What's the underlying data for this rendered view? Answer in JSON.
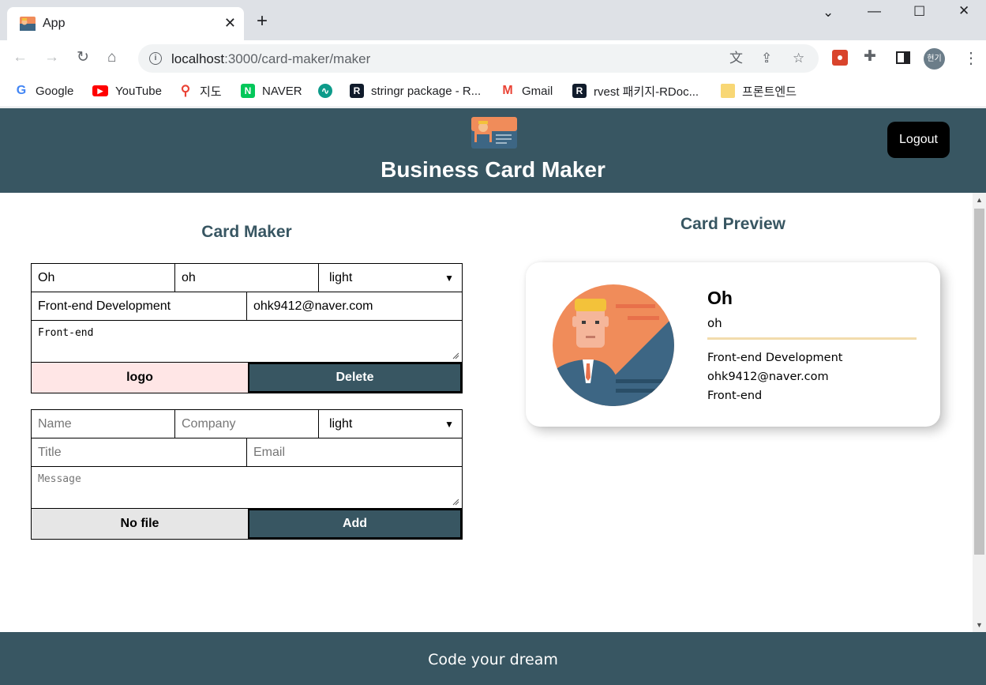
{
  "browser": {
    "tab_title": "App",
    "url_host": "localhost",
    "url_path": ":3000/card-maker/maker",
    "profile_label": "현기",
    "bookmarks": [
      {
        "label": "Google",
        "icon": "google-icon"
      },
      {
        "label": "YouTube",
        "icon": "youtube-icon"
      },
      {
        "label": "지도",
        "icon": "maps-icon"
      },
      {
        "label": "NAVER",
        "icon": "naver-icon"
      },
      {
        "label": "",
        "icon": "extension-bookmark-icon"
      },
      {
        "label": "stringr package - R...",
        "icon": "rdocumentation-icon"
      },
      {
        "label": "Gmail",
        "icon": "gmail-icon"
      },
      {
        "label": "rvest 패키지-RDoc...",
        "icon": "rdocumentation-icon"
      },
      {
        "label": "프론트엔드",
        "icon": "folder-icon"
      }
    ]
  },
  "header": {
    "title": "Business Card Maker",
    "logout_label": "Logout"
  },
  "maker": {
    "title": "Card Maker",
    "card_form": {
      "name": "Oh",
      "company": "oh",
      "theme": "light",
      "title": "Front-end Development",
      "email": "ohk9412@naver.com",
      "message": "Front-end",
      "file_label": "logo",
      "delete_label": "Delete"
    },
    "add_form": {
      "name_placeholder": "Name",
      "company_placeholder": "Company",
      "theme": "light",
      "title_placeholder": "Title",
      "email_placeholder": "Email",
      "message_placeholder": "Message",
      "file_label": "No file",
      "add_label": "Add"
    }
  },
  "preview": {
    "title": "Card Preview",
    "card": {
      "name": "Oh",
      "company": "oh",
      "title": "Front-end Development",
      "email": "ohk9412@naver.com",
      "message": "Front-end"
    }
  },
  "footer": {
    "text": "Code your dream"
  },
  "colors": {
    "brand": "#385662",
    "logo_button_bg": "#ffe6e6",
    "nofile_button_bg": "#e6e6e6",
    "card_divider": "#f2dcad"
  }
}
